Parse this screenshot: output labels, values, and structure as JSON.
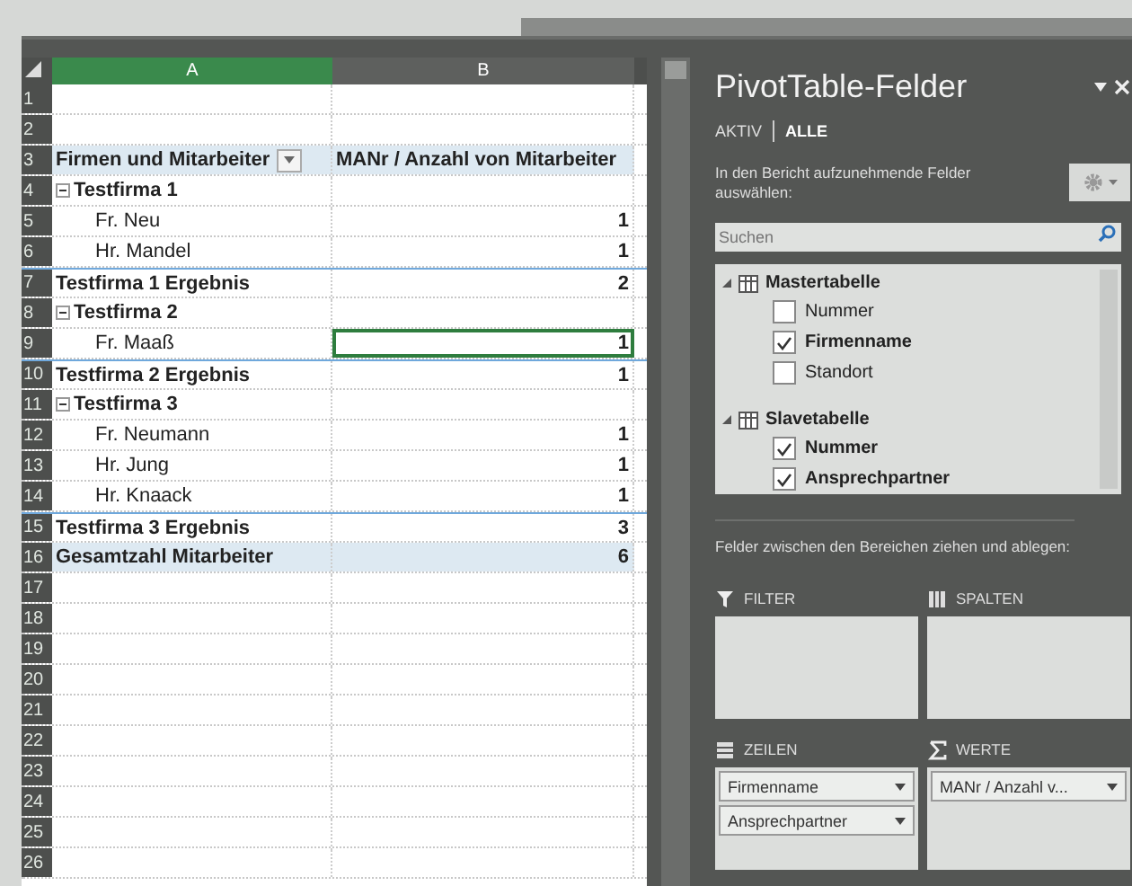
{
  "sheet": {
    "columns": [
      {
        "label": "A",
        "selected": true
      },
      {
        "label": "B",
        "selected": false
      }
    ],
    "rows": [
      {
        "num": "1",
        "kind": "empty"
      },
      {
        "num": "2",
        "kind": "empty"
      },
      {
        "num": "3",
        "kind": "header",
        "a": "Firmen und Mitarbeiter",
        "b": "MANr / Anzahl von Mitarbeiter"
      },
      {
        "num": "4",
        "kind": "group",
        "a": "Testfirma 1",
        "expanded": true
      },
      {
        "num": "5",
        "kind": "item",
        "a": "Fr. Neu",
        "b": "1"
      },
      {
        "num": "6",
        "kind": "item",
        "a": "Hr. Mandel",
        "b": "1"
      },
      {
        "num": "7",
        "kind": "subtotal",
        "a": "Testfirma 1 Ergebnis",
        "b": "2"
      },
      {
        "num": "8",
        "kind": "group",
        "a": "Testfirma 2",
        "expanded": true
      },
      {
        "num": "9",
        "kind": "item",
        "a": "Fr. Maaß",
        "b": "1",
        "selected": true
      },
      {
        "num": "10",
        "kind": "subtotal",
        "a": "Testfirma 2 Ergebnis",
        "b": "1"
      },
      {
        "num": "11",
        "kind": "group",
        "a": "Testfirma 3",
        "expanded": true
      },
      {
        "num": "12",
        "kind": "item",
        "a": "Fr. Neumann",
        "b": "1"
      },
      {
        "num": "13",
        "kind": "item",
        "a": "Hr. Jung",
        "b": "1"
      },
      {
        "num": "14",
        "kind": "item",
        "a": "Hr. Knaack",
        "b": "1"
      },
      {
        "num": "15",
        "kind": "subtotal",
        "a": "Testfirma 3 Ergebnis",
        "b": "3"
      },
      {
        "num": "16",
        "kind": "total",
        "a": "Gesamtzahl Mitarbeiter",
        "b": "6"
      },
      {
        "num": "17",
        "kind": "empty"
      },
      {
        "num": "18",
        "kind": "empty"
      },
      {
        "num": "19",
        "kind": "empty"
      },
      {
        "num": "20",
        "kind": "empty"
      },
      {
        "num": "21",
        "kind": "empty"
      },
      {
        "num": "22",
        "kind": "empty"
      },
      {
        "num": "23",
        "kind": "empty"
      },
      {
        "num": "24",
        "kind": "empty"
      },
      {
        "num": "25",
        "kind": "empty"
      },
      {
        "num": "26",
        "kind": "empty"
      }
    ]
  },
  "pane": {
    "title": "PivotTable-Felder",
    "tabs": [
      {
        "label": "AKTIV",
        "selected": false
      },
      {
        "label": "ALLE",
        "selected": true
      }
    ],
    "hint": "In den Bericht aufzunehmende Felder auswählen:",
    "search": {
      "placeholder": "Suchen"
    },
    "tables": [
      {
        "name": "Mastertabelle",
        "expanded": true,
        "children": [
          {
            "name": "Nummer",
            "checked": false
          },
          {
            "name": "Firmenname",
            "checked": true
          },
          {
            "name": "Standort",
            "checked": false
          }
        ]
      },
      {
        "name": "Slavetabelle",
        "expanded": true,
        "children": [
          {
            "name": "Nummer",
            "checked": true
          },
          {
            "name": "Ansprechpartner",
            "checked": true
          }
        ]
      }
    ],
    "drag_hint": "Felder zwischen den Bereichen ziehen und ablegen:",
    "areas": [
      {
        "kind": "filter",
        "label": "FILTER"
      },
      {
        "kind": "columns",
        "label": "SPALTEN"
      },
      {
        "kind": "rows",
        "label": "ZEILEN",
        "items": [
          "Firmenname",
          "Ansprechpartner"
        ]
      },
      {
        "kind": "values",
        "label": "WERTE",
        "items": [
          "MANr / Anzahl v..."
        ]
      }
    ]
  }
}
